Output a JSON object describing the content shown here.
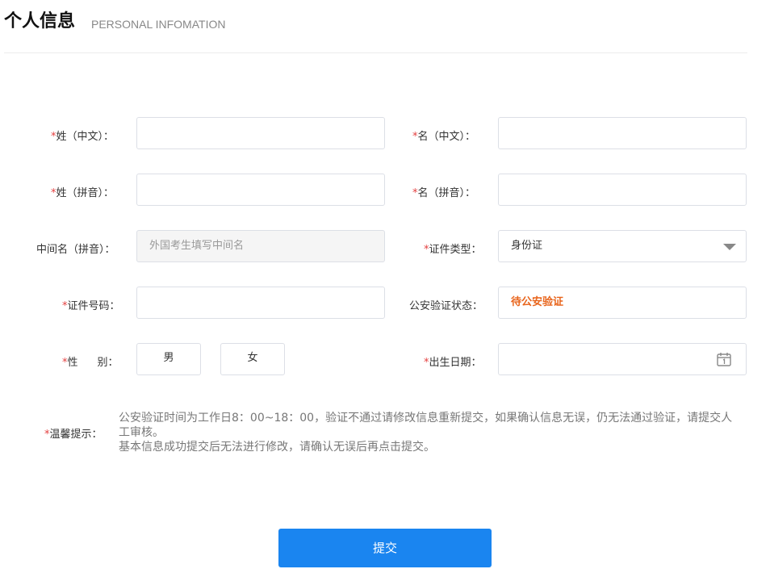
{
  "header": {
    "title": "个人信息",
    "subtitle": "PERSONAL INFOMATION"
  },
  "form": {
    "required_mark": "*",
    "surname_cn": {
      "label": "姓（中文）：",
      "value": ""
    },
    "given_cn": {
      "label": "名（中文）：",
      "value": ""
    },
    "surname_py": {
      "label": "姓（拼音）：",
      "value": ""
    },
    "given_py": {
      "label": "名（拼音）：",
      "value": ""
    },
    "middle_name": {
      "label": "中间名（拼音）：",
      "placeholder": "外国考生填写中间名"
    },
    "id_type": {
      "label": "证件类型：",
      "selected": "身份证"
    },
    "id_number": {
      "label": "证件号码：",
      "value": ""
    },
    "police_status": {
      "label": "公安验证状态：",
      "value": "待公安验证"
    },
    "gender": {
      "label_a": "性",
      "label_b": "别：",
      "options": [
        "男",
        "女"
      ]
    },
    "birth_date": {
      "label": "出生日期：",
      "value": ""
    }
  },
  "tips": {
    "label": "温馨提示：",
    "line1": "公安验证时间为工作日8：00~18：00，验证不通过请修改信息重新提交，如果确认信息无误，仍无法通过验证，请提交人工审核。",
    "line2": "基本信息成功提交后无法进行修改，请确认无误后再点击提交。"
  },
  "submit": {
    "label": "提交"
  },
  "colors": {
    "required": "#e43f3f",
    "primary": "#1a85f0",
    "status": "#e8641b"
  },
  "icons": {
    "dropdown": "chevron-down-icon",
    "date": "calendar-icon"
  }
}
